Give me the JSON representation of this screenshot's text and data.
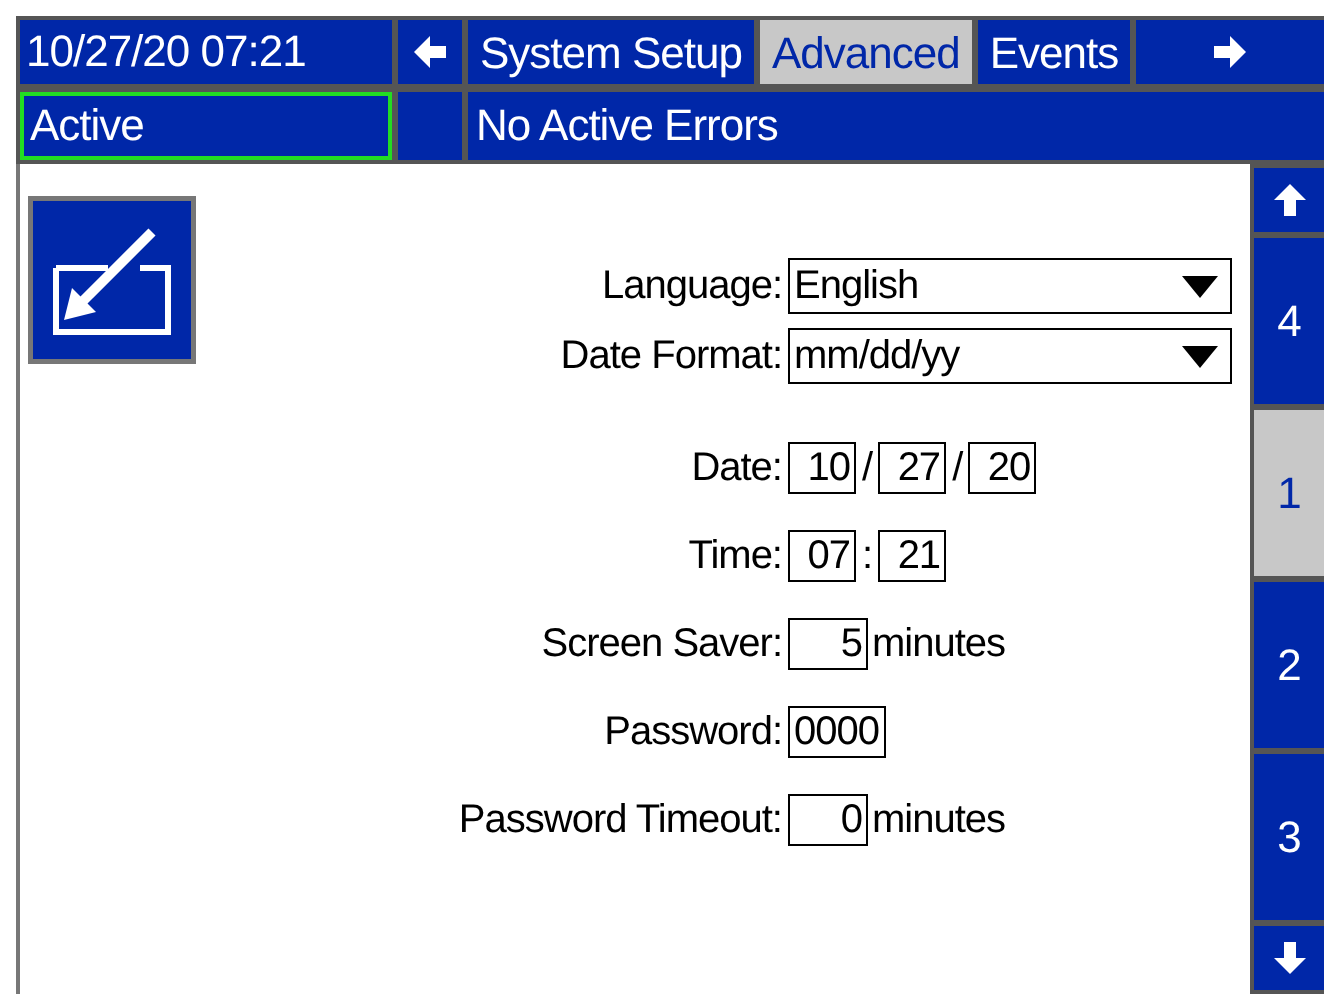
{
  "header": {
    "datetime": "10/27/20 07:21",
    "tabs": [
      {
        "label": "System Setup",
        "selected": false
      },
      {
        "label": "Advanced",
        "selected": true
      },
      {
        "label": "Events",
        "selected": false
      }
    ]
  },
  "status_bar": {
    "state": "Active",
    "message": "No Active Errors"
  },
  "fields": [
    {
      "kind": "dropdown",
      "label": "Language:",
      "value": "English"
    },
    {
      "kind": "dropdown",
      "label": "Date Format:",
      "value": "mm/dd/yy"
    },
    {
      "kind": "parts",
      "label": "Date:",
      "parts": [
        "10",
        "27",
        "20"
      ],
      "separator": "/"
    },
    {
      "kind": "parts",
      "label": "Time:",
      "parts": [
        "07",
        "21"
      ],
      "separator": ":"
    },
    {
      "kind": "number",
      "label": "Screen Saver:",
      "value": "5",
      "unit": "minutes"
    },
    {
      "kind": "number",
      "label": "Password:",
      "value": "0000"
    },
    {
      "kind": "number",
      "label": "Password Timeout:",
      "value": "0",
      "unit": "minutes"
    }
  ],
  "pages": [
    {
      "label": "4",
      "selected": false
    },
    {
      "label": "1",
      "selected": true
    },
    {
      "label": "2",
      "selected": false
    },
    {
      "label": "3",
      "selected": false
    }
  ]
}
